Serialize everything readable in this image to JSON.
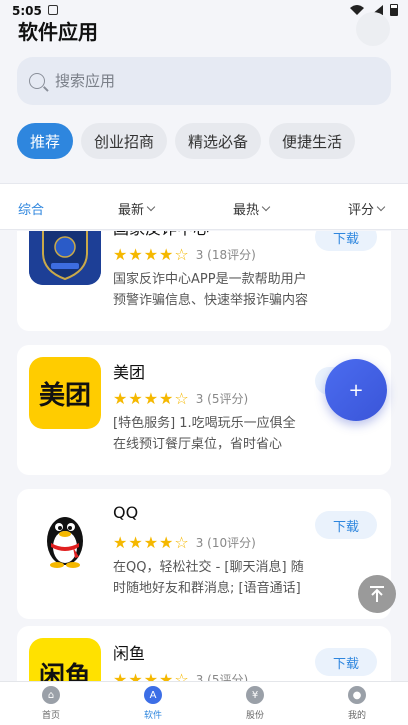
{
  "status_bar": {
    "time": "5:05"
  },
  "header": {
    "title": "软件应用"
  },
  "search": {
    "placeholder": "搜索应用"
  },
  "categories": [
    "推荐",
    "创业招商",
    "精选必备",
    "便捷生活"
  ],
  "sort_options": [
    "综合",
    "最新",
    "最热",
    "评分"
  ],
  "apps": [
    {
      "name": "国家反诈中心",
      "rating": "3 (18评分)",
      "stars": 3,
      "description": "国家反诈中心APP是一款帮助用户预警诈骗信息、快速举报诈骗内容的应用",
      "download_label": "下载",
      "icon_text": "国家反诈中心"
    },
    {
      "name": "美团",
      "rating": "3 (5评分)",
      "stars": 3,
      "description": "[特色服务] 1.吃喝玩乐一应俱全 在线预订餐厅桌位，省时省心",
      "download_label": "下载",
      "icon_text": "美团"
    },
    {
      "name": "QQ",
      "rating": "3 (10评分)",
      "stars": 3,
      "description": "在QQ，轻松社交 - [聊天消息] 随时随地好友和群消息; [语音通话]",
      "download_label": "下载",
      "icon_text": ""
    },
    {
      "name": "闲鱼",
      "rating": "3 (5评分)",
      "stars": 3,
      "description": "",
      "download_label": "下载",
      "icon_text": "闲鱼"
    }
  ],
  "fab": {
    "label": "+"
  },
  "tabbar": [
    "首页",
    "软件",
    "股份",
    "我的"
  ],
  "colors": {
    "accent": "#2e86de",
    "star": "#f5b800",
    "meituan_yellow": "#ffcc00"
  }
}
